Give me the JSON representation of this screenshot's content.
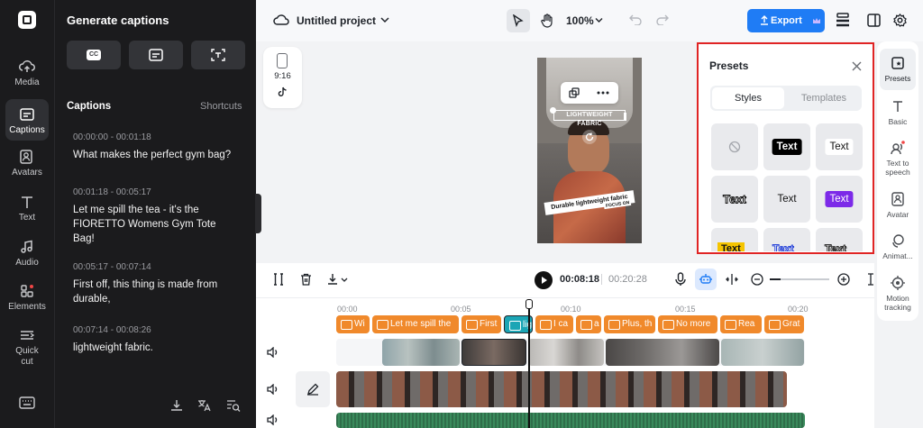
{
  "rail": {
    "items": [
      {
        "label": "Media"
      },
      {
        "label": "Captions"
      },
      {
        "label": "Avatars"
      },
      {
        "label": "Text"
      },
      {
        "label": "Audio"
      },
      {
        "label": "Elements"
      },
      {
        "label": "Quick cut"
      }
    ]
  },
  "panel": {
    "title": "Generate captions",
    "cc_label": "CC",
    "captions_heading": "Captions",
    "shortcuts_label": "Shortcuts",
    "items": [
      {
        "time": "00:00:00 - 00:01:18",
        "text": "What makes the perfect gym bag?"
      },
      {
        "time": "00:01:18 - 00:05:17",
        "text": "Let me spill the tea - it's the FIORETTO Womens Gym Tote Bag!"
      },
      {
        "time": "00:05:17 - 00:07:14",
        "text": "First off, this thing is made from durable,"
      },
      {
        "time": "00:07:14 - 00:08:26",
        "text": "lightweight fabric."
      }
    ]
  },
  "topbar": {
    "project_title": "Untitled project",
    "zoom": "100%",
    "export_label": "Export"
  },
  "aspect": {
    "ratio": "9:16"
  },
  "preview": {
    "caption_top": "LIGHTWEIGHT FABRIC",
    "caption_bottom_1": "Durable lightweight fabric",
    "caption_bottom_2": "FOCUS ON"
  },
  "presets": {
    "title": "Presets",
    "tab_styles": "Styles",
    "tab_templates": "Templates",
    "text_label": "Text"
  },
  "right_rail": {
    "items": [
      {
        "label": "Presets"
      },
      {
        "label": "Basic"
      },
      {
        "label": "Text to speech"
      },
      {
        "label": "Avatar"
      },
      {
        "label": "Animat..."
      },
      {
        "label": "Motion tracking"
      }
    ]
  },
  "timeline": {
    "current_time": "00:08:18",
    "total_time": "00:20:28",
    "ruler": [
      "00:00",
      "00:05",
      "00:10",
      "00:15",
      "00:20"
    ],
    "caption_clips": [
      "Wi",
      "Let me spill the",
      "First",
      "light",
      "I ca",
      "a",
      "Plus, th",
      "No more",
      "Rea",
      "Grat"
    ]
  },
  "colors": {
    "accent": "#1f7cf5",
    "caption_clip": "#f0892b",
    "highlight_border": "#e02424",
    "teal": "#1ba5b5"
  }
}
